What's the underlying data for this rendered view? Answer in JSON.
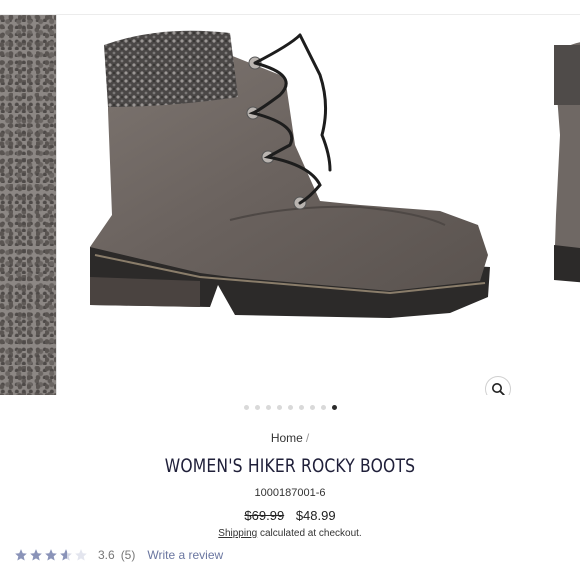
{
  "gallery": {
    "slide_count": 9,
    "active_index": 8,
    "zoom_icon": "magnifier-icon"
  },
  "breadcrumb": {
    "home": "Home",
    "separator": "/"
  },
  "product": {
    "title": "WOMEN'S HIKER ROCKY BOOTS",
    "sku": "1000187001-6",
    "price_original": "$69.99",
    "price_sale": "$48.99",
    "shipping_prefix": "Shipping",
    "shipping_suffix": " calculated at checkout."
  },
  "reviews": {
    "rating": 3.6,
    "rating_text": "3.6",
    "count_text": "(5)",
    "write_label": "Write a review",
    "star_color": "#8a93b8"
  },
  "colors": {
    "title": "#20203a",
    "link": "#6a76a0"
  }
}
